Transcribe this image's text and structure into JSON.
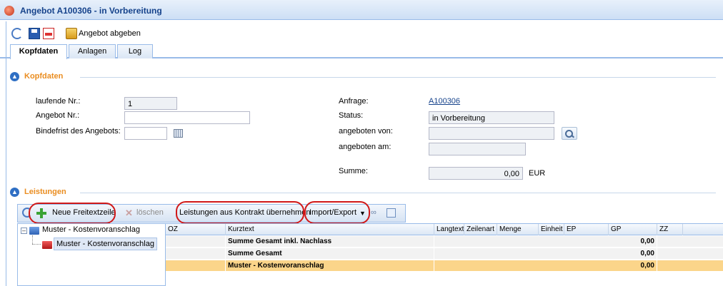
{
  "window": {
    "title": "Angebot A100306 - in Vorbereitung",
    "icon": "app-icon"
  },
  "toolbar": {
    "refresh_icon": "refresh-icon",
    "save_icon": "save-icon",
    "pdf_icon": "pdf-icon",
    "submit_label": "Angebot abgeben"
  },
  "tabs": [
    {
      "label": "Kopfdaten",
      "active": true
    },
    {
      "label": "Anlagen",
      "active": false
    },
    {
      "label": "Log",
      "active": false
    }
  ],
  "kopfdaten": {
    "section_title": "Kopfdaten",
    "laufende_nr_label": "laufende Nr.:",
    "laufende_nr_value": "1",
    "angebot_nr_label": "Angebot Nr.:",
    "angebot_nr_value": "",
    "bindefrist_label": "Bindefrist des Angebots:",
    "bindefrist_value": "",
    "anfrage_label": "Anfrage:",
    "anfrage_value": "A100306",
    "status_label": "Status:",
    "status_value": "in Vorbereitung",
    "angeboten_von_label": "angeboten von:",
    "angeboten_von_value": "",
    "angeboten_am_label": "angeboten am:",
    "angeboten_am_value": "",
    "summe_label": "Summe:",
    "summe_value": "0,00",
    "currency": "EUR"
  },
  "leistungen": {
    "section_title": "Leistungen",
    "toolbar": {
      "new_label": "Neue Freitextzeile",
      "delete_label": "löschen",
      "contract_label": "Leistungen aus Kontrakt übernehmen",
      "import_export_label": "Import/Export",
      "highlight_color": "#d01818"
    },
    "tree": {
      "root": "Muster - Kostenvoranschlag",
      "child": "Muster - Kostenvoranschlag"
    },
    "grid": {
      "columns": [
        "OZ",
        "Kurztext",
        "Langtext",
        "Zeilenart",
        "Menge",
        "Einheit",
        "EP",
        "GP",
        "ZZ"
      ],
      "rows": [
        {
          "oz": "",
          "kurztext": "Summe Gesamt inkl. Nachlass",
          "gp": "0,00"
        },
        {
          "oz": "",
          "kurztext": "Summe Gesamt",
          "gp": "0,00"
        },
        {
          "oz": "",
          "kurztext": "Muster - Kostenvoranschlag",
          "gp": "0,00"
        }
      ]
    }
  },
  "colors": {
    "accent_orange": "#ea8d20",
    "header_blue": "#15428b",
    "selection": "#fbd58a"
  }
}
